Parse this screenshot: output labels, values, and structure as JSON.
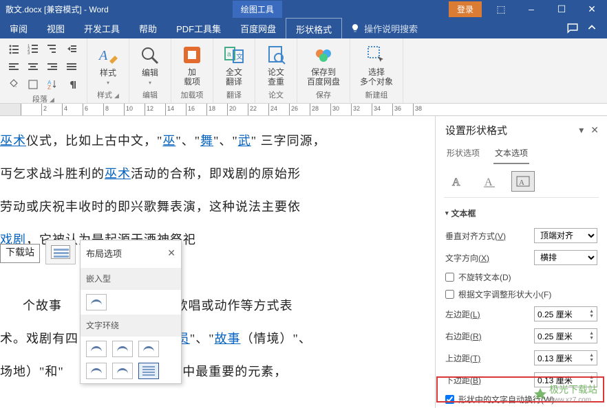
{
  "titlebar": {
    "title": "散文.docx [兼容模式] - Word",
    "context_tool": "绘图工具",
    "login": "登录",
    "minimize": "–",
    "maximize": "☐",
    "close": "✕",
    "ribbon_opts": "⬚"
  },
  "tabs": {
    "review": "审阅",
    "view": "视图",
    "dev": "开发工具",
    "help": "帮助",
    "pdf": "PDF工具集",
    "baidu": "百度网盘",
    "shape_format": "形状格式",
    "tellme": "操作说明搜索"
  },
  "ribbon": {
    "paragraph": "段落",
    "styles": "样式",
    "styles_btn": "样式",
    "editing": "编辑",
    "editing_btn": "编辑",
    "addon": "加载项",
    "addon_btn": "加\n载项",
    "translate": "翻译",
    "translate_btn": "全文\n翻译",
    "thesis": "论文",
    "thesis_btn": "论文\n查重",
    "save": "保存",
    "save_btn": "保存到\n百度网盘",
    "newgroup": "新建组",
    "select_multi": "选择\n多个对象"
  },
  "doc": {
    "p1a": "巫术",
    "p1b": "仪式，比如上古中文，\"",
    "p1c": "巫",
    "p1d": "\"、\"",
    "p1e": "舞",
    "p1f": "\"、\"",
    "p1g": "武",
    "p1h": "\" 三字同源，",
    "p2a": "丏乞求战斗胜利的",
    "p2b": "巫术",
    "p2c": "活动的合称，即戏剧的原始形",
    "p3": "劳动或庆祝丰收时的即兴歌舞表演，这种说法主要依",
    "p4a": "戏剧",
    "p4b": "，它被认为是起源于酒神祭祀",
    "shape_text": "下载站",
    "p5a": "个故事",
    "p5b": "活、歌唱或动作等方式表",
    "p6a": "术。戏剧有四",
    "p6b": "演员",
    "p6c": "\"、\"",
    "p6d": "故事",
    "p6e": "（情境）\"、",
    "p7a": "场地）\"和\"",
    "p7b": "四者当中最重要的元素，"
  },
  "layout_popup": {
    "title": "布局选项",
    "close": "✕",
    "inline": "嵌入型",
    "wrap": "文字环绕"
  },
  "sidepanel": {
    "title": "设置形状格式",
    "tab_shape": "形状选项",
    "tab_text": "文本选项",
    "section_textbox": "文本框",
    "valign_label": "垂直对齐方式",
    "valign_u": "(V)",
    "valign_value": "顶端对齐",
    "textdir_label": "文字方向",
    "textdir_u": "(X)",
    "textdir_value": "横排",
    "norotate": "不旋转文本",
    "norotate_u": "(D)",
    "autosize": "根据文字调整形状大小",
    "autosize_u": "(F)",
    "left_label": "左边距",
    "left_u": "(L)",
    "left_val": "0.25 厘米",
    "right_label": "右边距",
    "right_u": "(R)",
    "right_val": "0.25 厘米",
    "top_label": "上边距",
    "top_u": "(T)",
    "top_val": "0.13 厘米",
    "bottom_label": "下边距",
    "bottom_u": "(B)",
    "bottom_val": "0.13 厘米",
    "wrap_label": "形状中的文字自动换行",
    "wrap_u": "(W)"
  },
  "watermark": {
    "main": "极光下载站",
    "sub": "www.xz7.com"
  }
}
